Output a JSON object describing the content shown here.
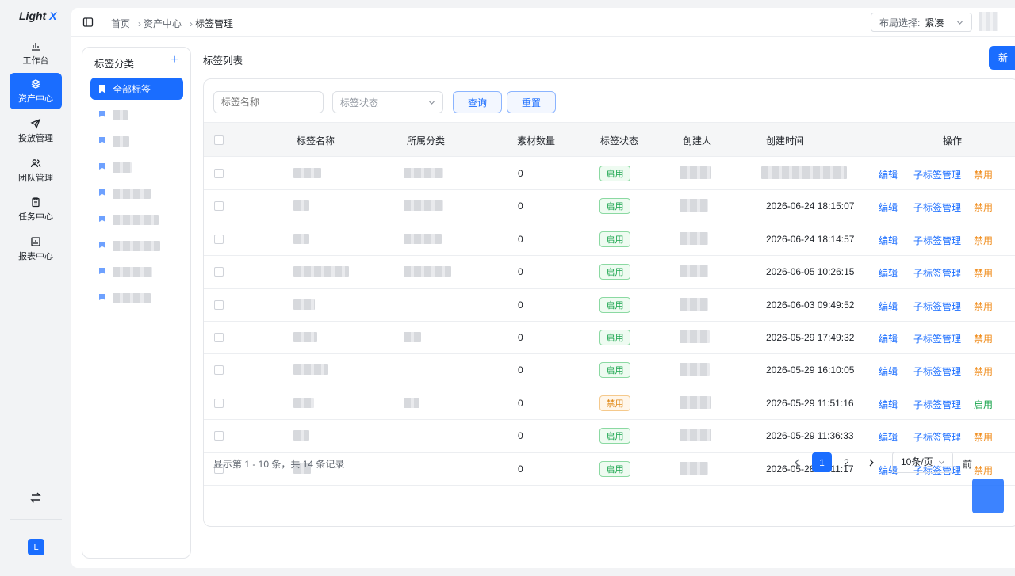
{
  "app": {
    "logo_main": "Light",
    "logo_accent": "X"
  },
  "rail": [
    {
      "label": "工作台",
      "icon": "chart-bar-icon"
    },
    {
      "label": "资产中心",
      "icon": "layers-icon",
      "active": true
    },
    {
      "label": "投放管理",
      "icon": "send-icon"
    },
    {
      "label": "团队管理",
      "icon": "users-icon"
    },
    {
      "label": "任务中心",
      "icon": "clipboard-icon"
    },
    {
      "label": "报表中心",
      "icon": "report-icon"
    }
  ],
  "user_initial": "L",
  "breadcrumb": [
    "首页",
    "资产中心",
    "标签管理"
  ],
  "layout_select": {
    "label": "布局选择:",
    "value": "紧凑"
  },
  "category_panel": {
    "title": "标签分类",
    "all_label": "全部标签"
  },
  "list": {
    "title": "标签列表",
    "new_button": "新"
  },
  "filters": {
    "name_placeholder": "标签名称",
    "status_placeholder": "标签状态",
    "query_button": "查询",
    "reset_button": "重置"
  },
  "table": {
    "headers": [
      "标签名称",
      "所属分类",
      "素材数量",
      "标签状态",
      "创建人",
      "创建时间",
      "操作"
    ],
    "rows": [
      {
        "count": "0",
        "status": "启用",
        "status_type": "on",
        "created": "",
        "toggle": "禁用"
      },
      {
        "count": "0",
        "status": "启用",
        "status_type": "on",
        "created": "2026-06-24 18:15:07",
        "toggle": "禁用"
      },
      {
        "count": "0",
        "status": "启用",
        "status_type": "on",
        "created": "2026-06-24 18:14:57",
        "toggle": "禁用"
      },
      {
        "count": "0",
        "status": "启用",
        "status_type": "on",
        "created": "2026-06-05 10:26:15",
        "toggle": "禁用"
      },
      {
        "count": "0",
        "status": "启用",
        "status_type": "on",
        "created": "2026-06-03 09:49:52",
        "toggle": "禁用"
      },
      {
        "count": "0",
        "status": "启用",
        "status_type": "on",
        "created": "2026-05-29 17:49:32",
        "toggle": "禁用"
      },
      {
        "count": "0",
        "status": "启用",
        "status_type": "on",
        "created": "2026-05-29 16:10:05",
        "toggle": "禁用"
      },
      {
        "count": "0",
        "status": "禁用",
        "status_type": "off",
        "created": "2026-05-29 11:51:16",
        "toggle": "启用"
      },
      {
        "count": "0",
        "status": "启用",
        "status_type": "on",
        "created": "2026-05-29 11:36:33",
        "toggle": "禁用"
      },
      {
        "count": "0",
        "status": "启用",
        "status_type": "on",
        "created": "2026-05-28 15:11:17",
        "toggle": "禁用"
      }
    ],
    "actions": {
      "edit": "编辑",
      "children": "子标签管理"
    }
  },
  "pagination": {
    "info": "显示第 1 - 10 条，共 14 条记录",
    "pages": [
      "1",
      "2"
    ],
    "page_size": "10条/页",
    "jump_label": "前"
  },
  "colors": {
    "accent": "#1a6dff",
    "enabled": "#16a34a",
    "disabled": "#f08c1b"
  }
}
